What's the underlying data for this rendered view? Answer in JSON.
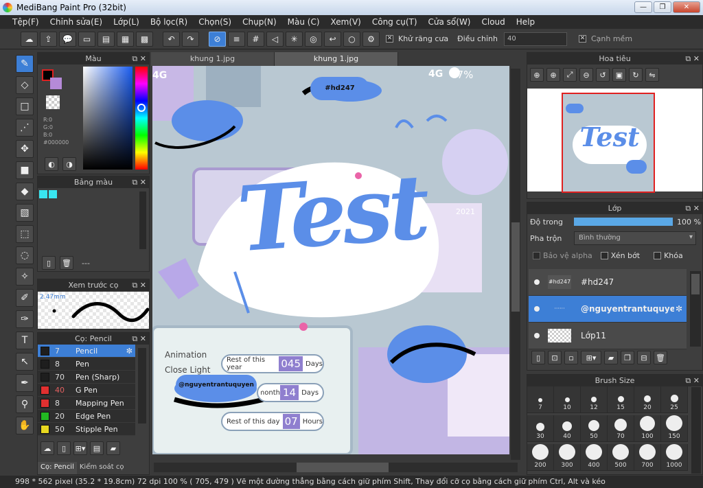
{
  "window": {
    "title": "MediBang Paint Pro (32bit)",
    "min": "—",
    "max": "❐",
    "close": "✕"
  },
  "menu": [
    "Tệp(F)",
    "Chỉnh sửa(E)",
    "Lớp(L)",
    "Bộ lọc(R)",
    "Chọn(S)",
    "Chụp(N)",
    "Màu (C)",
    "Xem(V)",
    "Công cụ(T)",
    "Cửa sổ(W)",
    "Cloud",
    "Help"
  ],
  "toolbar": {
    "antialias_label": "Khử răng cưa",
    "adjust_label": "Điều chỉnh",
    "adjust_value": "40",
    "smooth_label": "Cạnh mềm"
  },
  "color_panel": {
    "title": "Màu",
    "r": "R:0",
    "g": "G:0",
    "b": "B:0",
    "hex": "#000000"
  },
  "palette_panel": {
    "title": "Bảng màu",
    "dashes": "---"
  },
  "brush_preview": {
    "title": "Xem trước cọ",
    "size": "2.47mm"
  },
  "brush_panel": {
    "title": "Cọ: Pencil",
    "items": [
      {
        "size": "7",
        "name": "Pencil",
        "color": "#1e1e1e"
      },
      {
        "size": "8",
        "name": "Pen",
        "color": "#1e1e1e"
      },
      {
        "size": "70",
        "name": "Pen (Sharp)",
        "color": "#1e1e1e"
      },
      {
        "size": "40",
        "name": "G Pen",
        "color": "#e03030"
      },
      {
        "size": "8",
        "name": "Mapping Pen",
        "color": "#e03030"
      },
      {
        "size": "20",
        "name": "Edge Pen",
        "color": "#22b822"
      },
      {
        "size": "50",
        "name": "Stipple Pen",
        "color": "#e8d820"
      }
    ],
    "tab1": "Cọ: Pencil",
    "tab2": "Kiểm soát cọ"
  },
  "tabs": [
    "khung 1.jpg",
    "khung 1.jpg"
  ],
  "canvas": {
    "title": "Test",
    "tag1": "#hd247",
    "tag2": "@nguyentrantuquyen",
    "year": "2021",
    "signal": "4G",
    "battery": "47%",
    "animation": "Animation",
    "close_light": "Close Light",
    "rows": [
      {
        "label": "Rest of this year",
        "value": "045",
        "unit": "Days"
      },
      {
        "label": "Rest of this month",
        "value": "14",
        "unit": "Days"
      },
      {
        "label": "Rest of this day",
        "value": "07",
        "unit": "Hours"
      }
    ]
  },
  "navigator": {
    "title": "Hoa tiêu",
    "preview_text": "Test"
  },
  "layer_panel": {
    "title": "Lớp",
    "opacity_label": "Độ trong",
    "opacity": 100,
    "opacity_text": "100 %",
    "blend_label": "Pha trộn",
    "blend_value": "Bình thường",
    "protect_alpha": "Bảo vệ alpha",
    "clip": "Xén bớt",
    "lock": "Khóa",
    "layers": [
      {
        "name": "#hd247",
        "thumb": "#hd247"
      },
      {
        "name": "@nguyentrantuquyen",
        "thumb": "······"
      },
      {
        "name": "Lớp11",
        "thumb": ""
      }
    ]
  },
  "brush_size": {
    "title": "Brush Size",
    "sizes": [
      "7",
      "10",
      "12",
      "15",
      "20",
      "25",
      "30",
      "40",
      "50",
      "70",
      "100",
      "150",
      "200",
      "300",
      "400",
      "500",
      "700",
      "1000"
    ]
  },
  "status": "998 * 562 pixel   (35.2 * 19.8cm)   72 dpi   100 %   ( 705, 479 )   Vẽ một đường thẳng bằng cách giữ phím Shift, Thay đổi cỡ cọ bằng cách giữ phím Ctrl, Alt và kéo",
  "colors": {
    "accent": "#3d7fd6",
    "canvas_blue": "#5b8ee8",
    "dark": "#2b2b2b"
  }
}
